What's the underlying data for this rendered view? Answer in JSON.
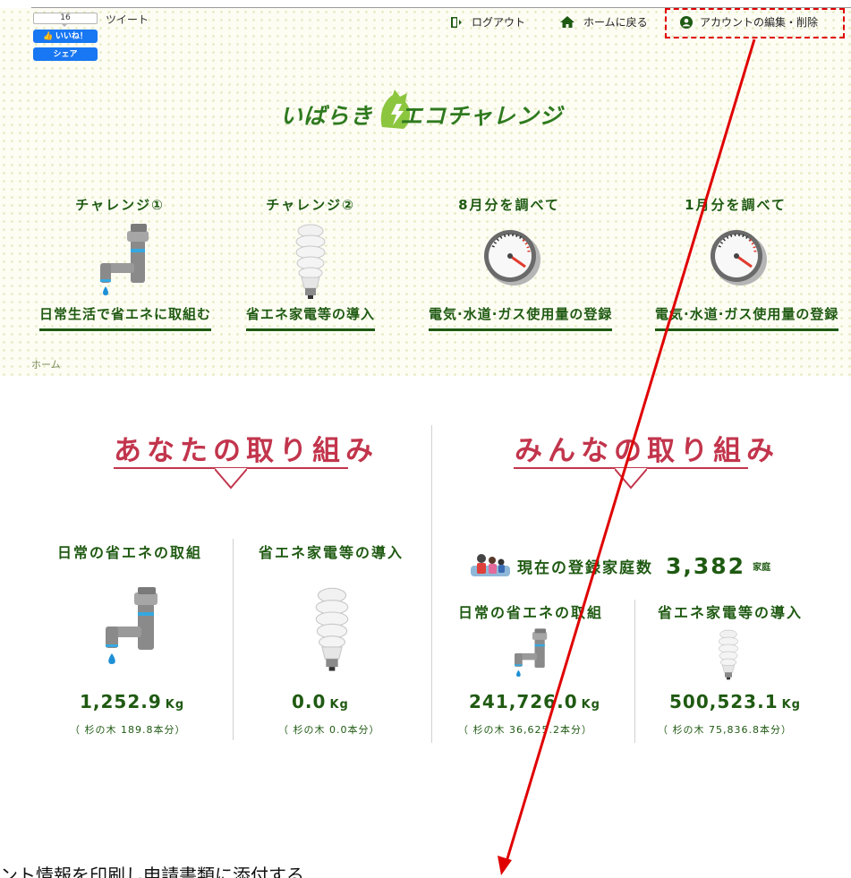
{
  "social": {
    "like_count": "16",
    "like_label": "いいね！",
    "share_label": "シェア",
    "tweet_label": "ツイート"
  },
  "nav": {
    "logout": "ログアウト",
    "home": "ホームに戻る",
    "account": "アカウントの編集・削除"
  },
  "logo": {
    "part1": "いばらき",
    "part2": "エコチャレンジ"
  },
  "challenges": [
    {
      "title": "チャレンジ①",
      "link": "日常生活で省エネに取組む",
      "icon": "faucet-icon"
    },
    {
      "title": "チャレンジ②",
      "link": "省エネ家電等の導入",
      "icon": "led-bulb-icon"
    },
    {
      "title": "8月分を調べて",
      "link": "電気·水道·ガス使用量の登録",
      "icon": "meter-icon"
    },
    {
      "title": "1月分を調べて",
      "link": "電気·水道·ガス使用量の登録",
      "icon": "meter-icon"
    }
  ],
  "breadcrumb": "ホーム",
  "yours": {
    "title": "あなたの取り組み",
    "daily_title": "日常の省エネの取組",
    "daily_value": "1,252.9",
    "daily_unit": "Kg",
    "daily_sub": "（ 杉の木 189.8本分）",
    "appliance_title": "省エネ家電等の導入",
    "appliance_value": "0.0",
    "appliance_unit": "Kg",
    "appliance_sub": "（ 杉の木 0.0本分）"
  },
  "everyone": {
    "title": "みんなの取り組み",
    "households_label": "現在の登録家庭数",
    "households_count": "3,382",
    "households_unit": "家庭",
    "daily_title": "日常の省エネの取組",
    "daily_value": "241,726.0",
    "daily_unit": "Kg",
    "daily_sub": "（ 杉の木 36,625.2本分）",
    "appliance_title": "省エネ家電等の導入",
    "appliance_value": "500,523.1",
    "appliance_unit": "Kg",
    "appliance_sub": "（ 杉の木 75,836.8本分）"
  },
  "footer": "ント情報を印刷し申請書類に添付する",
  "colors": {
    "green": "#1f5a12",
    "logo_green": "#2f7a1f",
    "rose": "#c2354c",
    "annotation_red": "#e00000",
    "facebook_blue": "#1877f2"
  }
}
